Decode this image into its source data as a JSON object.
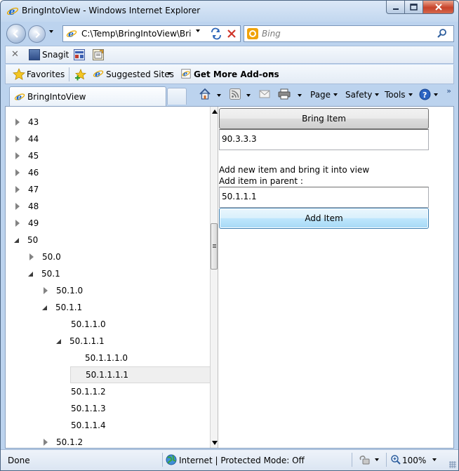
{
  "window": {
    "title": "BringIntoView - Windows Internet Explorer"
  },
  "address_bar": {
    "url": "C:\\Temp\\BringIntoView\\Bring"
  },
  "search": {
    "placeholder": "Bing"
  },
  "toolbar": {
    "snagit_label": "Snagit"
  },
  "favorites_bar": {
    "favorites_label": "Favorites",
    "suggested_sites_label": "Suggested Sites",
    "get_addons_label": "Get More Add-ons"
  },
  "tab": {
    "label": "BringIntoView"
  },
  "command_bar": {
    "page_label": "Page",
    "safety_label": "Safety",
    "tools_label": "Tools"
  },
  "tree": {
    "items": [
      {
        "label": "43",
        "level": 0,
        "state": "collapsed"
      },
      {
        "label": "44",
        "level": 0,
        "state": "collapsed"
      },
      {
        "label": "45",
        "level": 0,
        "state": "collapsed"
      },
      {
        "label": "46",
        "level": 0,
        "state": "collapsed"
      },
      {
        "label": "47",
        "level": 0,
        "state": "collapsed"
      },
      {
        "label": "48",
        "level": 0,
        "state": "collapsed"
      },
      {
        "label": "49",
        "level": 0,
        "state": "collapsed"
      },
      {
        "label": "50",
        "level": 0,
        "state": "expanded"
      },
      {
        "label": "50.0",
        "level": 1,
        "state": "collapsed"
      },
      {
        "label": "50.1",
        "level": 1,
        "state": "expanded"
      },
      {
        "label": "50.1.0",
        "level": 2,
        "state": "collapsed"
      },
      {
        "label": "50.1.1",
        "level": 2,
        "state": "expanded"
      },
      {
        "label": "50.1.1.0",
        "level": 3,
        "state": "none"
      },
      {
        "label": "50.1.1.1",
        "level": 3,
        "state": "expanded"
      },
      {
        "label": "50.1.1.1.0",
        "level": 4,
        "state": "none"
      },
      {
        "label": "50.1.1.1.1",
        "level": 4,
        "state": "none",
        "selected": true
      },
      {
        "label": "50.1.1.2",
        "level": 3,
        "state": "none"
      },
      {
        "label": "50.1.1.3",
        "level": 3,
        "state": "none"
      },
      {
        "label": "50.1.1.4",
        "level": 3,
        "state": "none"
      },
      {
        "label": "50.1.2",
        "level": 2,
        "state": "collapsed"
      }
    ]
  },
  "form": {
    "bring_item_label": "Bring Item",
    "bring_item_value": "90.3.3.3",
    "add_new_caption": "Add new item and bring it into view",
    "add_in_parent_caption": "Add item in parent :",
    "parent_value": "50.1.1.1",
    "add_item_label": "Add Item"
  },
  "status_bar": {
    "status_text": "Done",
    "zone_text": "Internet | Protected Mode: Off",
    "zoom_text": "100%"
  },
  "colors": {
    "frame": "#bcd3ee",
    "focus_border": "#3c7fb1"
  }
}
